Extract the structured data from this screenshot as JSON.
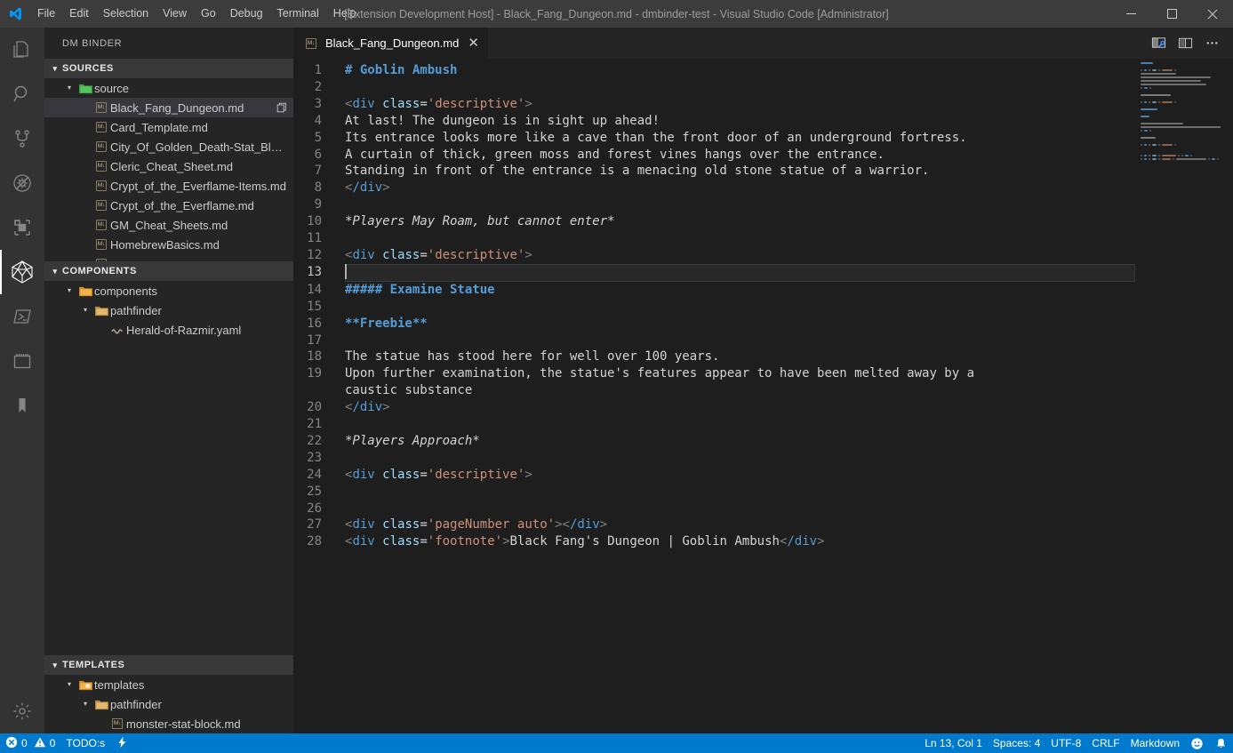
{
  "titlebar": {
    "logo_icon": "vscode-logo-icon",
    "menus": [
      "File",
      "Edit",
      "Selection",
      "View",
      "Go",
      "Debug",
      "Terminal",
      "Help"
    ],
    "window_title": "[Extension Development Host] - Black_Fang_Dungeon.md - dmbinder-test - Visual Studio Code [Administrator]",
    "controls": [
      {
        "name": "minimize-button",
        "glyph": "─"
      },
      {
        "name": "maximize-button",
        "glyph": "☐"
      },
      {
        "name": "close-button",
        "glyph": "✕"
      }
    ]
  },
  "activitybar": {
    "items": [
      {
        "name": "explorer",
        "icon": "files-icon",
        "active": false
      },
      {
        "name": "search",
        "icon": "search-icon",
        "active": false
      },
      {
        "name": "source-control",
        "icon": "source-control-icon",
        "active": false
      },
      {
        "name": "run-and-debug",
        "icon": "debug-disabled-icon",
        "active": false
      },
      {
        "name": "extensions",
        "icon": "extensions-icon",
        "active": false
      },
      {
        "name": "dm-binder",
        "icon": "d20-dice-icon",
        "active": true
      },
      {
        "name": "powershell",
        "icon": "terminal-prompt-icon",
        "active": false
      },
      {
        "name": "calendar",
        "icon": "calendar-icon",
        "active": false
      },
      {
        "name": "bookmarks",
        "icon": "bookmark-icon",
        "active": false
      }
    ],
    "bottom": [
      {
        "name": "manage-settings",
        "icon": "gear-icon"
      }
    ]
  },
  "sidebar": {
    "title": "DM BINDER",
    "panes": [
      {
        "name": "sources",
        "header": "SOURCES",
        "expanded": true,
        "rows": [
          {
            "label": "source",
            "indent": 1,
            "kind": "folder-green",
            "twisty": "open",
            "selected": false
          },
          {
            "label": "Black_Fang_Dungeon.md",
            "indent": 2,
            "kind": "md",
            "twisty": "none",
            "selected": true,
            "action_icon": "render-copy-icon"
          },
          {
            "label": "Card_Template.md",
            "indent": 2,
            "kind": "md",
            "twisty": "none",
            "selected": false
          },
          {
            "label": "City_Of_Golden_Death-Stat_Bloc...",
            "indent": 2,
            "kind": "md",
            "twisty": "none",
            "selected": false
          },
          {
            "label": "Cleric_Cheat_Sheet.md",
            "indent": 2,
            "kind": "md",
            "twisty": "none",
            "selected": false
          },
          {
            "label": "Crypt_of_the_Everflame-Items.md",
            "indent": 2,
            "kind": "md",
            "twisty": "none",
            "selected": false
          },
          {
            "label": "Crypt_of_the_Everflame.md",
            "indent": 2,
            "kind": "md",
            "twisty": "none",
            "selected": false
          },
          {
            "label": "GM_Cheat_Sheets.md",
            "indent": 2,
            "kind": "md",
            "twisty": "none",
            "selected": false
          },
          {
            "label": "HomebrewBasics.md",
            "indent": 2,
            "kind": "md",
            "twisty": "none",
            "selected": false
          },
          {
            "label": "",
            "indent": 2,
            "kind": "md",
            "twisty": "none",
            "selected": false,
            "clipped": true
          }
        ]
      },
      {
        "name": "components",
        "header": "COMPONENTS",
        "expanded": true,
        "rows": [
          {
            "label": "components",
            "indent": 1,
            "kind": "folder-orange",
            "twisty": "open",
            "selected": false
          },
          {
            "label": "pathfinder",
            "indent": 2,
            "kind": "folder-plain",
            "twisty": "open",
            "selected": false
          },
          {
            "label": "Herald-of-Razmir.yaml",
            "indent": 3,
            "kind": "yaml",
            "twisty": "none",
            "selected": false
          }
        ]
      },
      {
        "name": "templates",
        "header": "TEMPLATES",
        "expanded": true,
        "rows": [
          {
            "label": "templates",
            "indent": 1,
            "kind": "folder-template",
            "twisty": "open",
            "selected": false
          },
          {
            "label": "pathfinder",
            "indent": 2,
            "kind": "folder-plain",
            "twisty": "open",
            "selected": false
          },
          {
            "label": "monster-stat-block.md",
            "indent": 3,
            "kind": "md",
            "twisty": "none",
            "selected": false
          }
        ]
      }
    ]
  },
  "editor": {
    "tabs": [
      {
        "label": "Black_Fang_Dungeon.md",
        "icon": "markdown-file-icon",
        "active": true,
        "close_glyph": "✕"
      }
    ],
    "actions": [
      {
        "name": "open-preview-to-side-button",
        "icon": "preview-side-icon"
      },
      {
        "name": "split-editor-button",
        "icon": "split-editor-icon"
      },
      {
        "name": "more-actions-button",
        "icon": "ellipsis-icon"
      }
    ],
    "lines": [
      {
        "num": 1,
        "tokens": [
          {
            "t": "head",
            "v": "# Goblin Ambush"
          }
        ]
      },
      {
        "num": 2,
        "tokens": []
      },
      {
        "num": 3,
        "tokens": [
          {
            "t": "punc",
            "v": "<"
          },
          {
            "t": "tag",
            "v": "div"
          },
          {
            "t": "text",
            "v": " "
          },
          {
            "t": "attr",
            "v": "class"
          },
          {
            "t": "eq",
            "v": "="
          },
          {
            "t": "str",
            "v": "'descriptive'"
          },
          {
            "t": "punc",
            "v": ">"
          }
        ]
      },
      {
        "num": 4,
        "tokens": [
          {
            "t": "text",
            "v": "At last! The dungeon is in sight up ahead!"
          }
        ]
      },
      {
        "num": 5,
        "tokens": [
          {
            "t": "text",
            "v": "Its entrance looks more like a cave than the front door of an underground fortress."
          }
        ]
      },
      {
        "num": 6,
        "tokens": [
          {
            "t": "text",
            "v": "A curtain of thick, green moss and forest vines hangs over the entrance."
          }
        ]
      },
      {
        "num": 7,
        "tokens": [
          {
            "t": "text",
            "v": "Standing in front of the entrance is a menacing old stone statue of a warrior."
          }
        ]
      },
      {
        "num": 8,
        "tokens": [
          {
            "t": "punc",
            "v": "<"
          },
          {
            "t": "tag",
            "v": "/div"
          },
          {
            "t": "punc",
            "v": ">"
          }
        ]
      },
      {
        "num": 9,
        "tokens": []
      },
      {
        "num": 10,
        "tokens": [
          {
            "t": "em",
            "v": "*Players May Roam, but cannot enter*"
          }
        ]
      },
      {
        "num": 11,
        "tokens": []
      },
      {
        "num": 12,
        "tokens": [
          {
            "t": "punc",
            "v": "<"
          },
          {
            "t": "tag",
            "v": "div"
          },
          {
            "t": "text",
            "v": " "
          },
          {
            "t": "attr",
            "v": "class"
          },
          {
            "t": "eq",
            "v": "="
          },
          {
            "t": "str",
            "v": "'descriptive'"
          },
          {
            "t": "punc",
            "v": ">"
          }
        ]
      },
      {
        "num": 13,
        "tokens": [],
        "current": true,
        "cursor": true
      },
      {
        "num": 14,
        "tokens": [
          {
            "t": "head",
            "v": "##### Examine Statue"
          }
        ]
      },
      {
        "num": 15,
        "tokens": []
      },
      {
        "num": 16,
        "tokens": [
          {
            "t": "bold",
            "v": "**Freebie**"
          }
        ]
      },
      {
        "num": 17,
        "tokens": []
      },
      {
        "num": 18,
        "tokens": [
          {
            "t": "text",
            "v": "The statue has stood here for well over 100 years."
          }
        ]
      },
      {
        "num": 19,
        "tokens": [
          {
            "t": "text",
            "v": "Upon further examination, the statue's features appear to have been melted away by a caustic substance"
          }
        ]
      },
      {
        "num": 20,
        "tokens": [
          {
            "t": "punc",
            "v": "<"
          },
          {
            "t": "tag",
            "v": "/div"
          },
          {
            "t": "punc",
            "v": ">"
          }
        ]
      },
      {
        "num": 21,
        "tokens": []
      },
      {
        "num": 22,
        "tokens": [
          {
            "t": "em",
            "v": "*Players Approach*"
          }
        ]
      },
      {
        "num": 23,
        "tokens": []
      },
      {
        "num": 24,
        "tokens": [
          {
            "t": "punc",
            "v": "<"
          },
          {
            "t": "tag",
            "v": "div"
          },
          {
            "t": "text",
            "v": " "
          },
          {
            "t": "attr",
            "v": "class"
          },
          {
            "t": "eq",
            "v": "="
          },
          {
            "t": "str",
            "v": "'descriptive'"
          },
          {
            "t": "punc",
            "v": ">"
          }
        ]
      },
      {
        "num": 25,
        "tokens": []
      },
      {
        "num": 26,
        "tokens": []
      },
      {
        "num": 27,
        "tokens": [
          {
            "t": "punc",
            "v": "<"
          },
          {
            "t": "tag",
            "v": "div"
          },
          {
            "t": "text",
            "v": " "
          },
          {
            "t": "attr",
            "v": "class"
          },
          {
            "t": "eq",
            "v": "="
          },
          {
            "t": "str",
            "v": "'pageNumber auto'"
          },
          {
            "t": "punc",
            "v": ">"
          },
          {
            "t": "punc",
            "v": "<"
          },
          {
            "t": "tag",
            "v": "/div"
          },
          {
            "t": "punc",
            "v": ">"
          }
        ]
      },
      {
        "num": 28,
        "tokens": [
          {
            "t": "punc",
            "v": "<"
          },
          {
            "t": "tag",
            "v": "div"
          },
          {
            "t": "text",
            "v": " "
          },
          {
            "t": "attr",
            "v": "class"
          },
          {
            "t": "eq",
            "v": "="
          },
          {
            "t": "str",
            "v": "'footnote'"
          },
          {
            "t": "punc",
            "v": ">"
          },
          {
            "t": "text",
            "v": "Black Fang's Dungeon | Goblin Ambush"
          },
          {
            "t": "punc",
            "v": "<"
          },
          {
            "t": "tag",
            "v": "/div"
          },
          {
            "t": "punc",
            "v": ">"
          }
        ]
      }
    ]
  },
  "statusbar": {
    "left": [
      {
        "name": "problems",
        "icon": "error-icon",
        "text": "0",
        "icon2": "warning-icon",
        "text2": "0"
      },
      {
        "name": "todos",
        "text": "TODO:s"
      },
      {
        "name": "lightning",
        "icon": "lightning-icon",
        "text": ""
      }
    ],
    "right": [
      {
        "name": "editor-position",
        "text": "Ln 13, Col 1"
      },
      {
        "name": "indentation",
        "text": "Spaces: 4"
      },
      {
        "name": "encoding",
        "text": "UTF-8"
      },
      {
        "name": "eol",
        "text": "CRLF"
      },
      {
        "name": "language-mode",
        "text": "Markdown"
      },
      {
        "name": "feedback-smiley",
        "icon": "smiley-icon",
        "text": ""
      },
      {
        "name": "notifications-bell",
        "icon": "bell-icon",
        "text": ""
      }
    ]
  },
  "colors": {
    "titlebar_bg": "#3c3c3c",
    "activitybar_bg": "#333333",
    "sidebar_bg": "#252526",
    "editor_bg": "#1e1e1e",
    "statusbar_bg": "#007acc",
    "accent_blue": "#569cd6",
    "string_orange": "#ce9178",
    "attr_blue": "#9cdcfe",
    "selection_bg": "#37373d"
  }
}
